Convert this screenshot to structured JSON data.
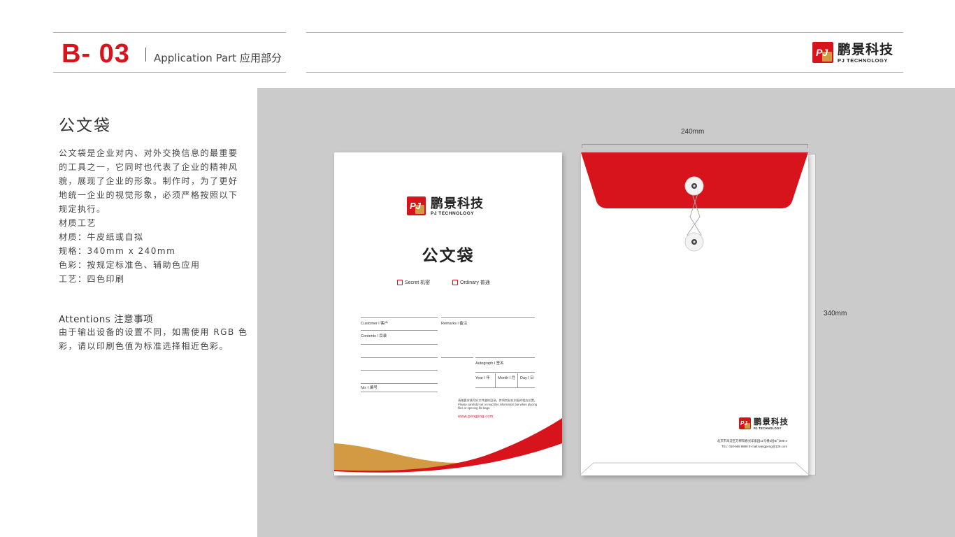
{
  "header": {
    "page_code": "B- 03",
    "section_title": "Application Part 应用部分"
  },
  "brand": {
    "name_cn": "鹏景科技",
    "name_en": "PJ TECHNOLOGY",
    "mark_letters": "PJ",
    "colors": {
      "red": "#d7141b",
      "gold": "#d39a43"
    }
  },
  "description": {
    "heading": "公文袋",
    "lines": [
      "公文袋是企业对内、对外交换信息的最重要",
      "的工具之一，它同时也代表了企业的精神风",
      "貌，展现了企业的形象。制作时，为了更好",
      "地统一企业的视觉形象，必须严格按照以下",
      "规定执行。",
      "材质工艺",
      "材质：牛皮纸或自拟",
      "规格：340mm x 240mm",
      "色彩：按规定标准色、辅助色应用",
      "工艺：四色印刷"
    ],
    "attentions_title": "Attentions 注意事项",
    "attentions_lines": [
      "由于输出设备的设置不同，如需使用 RGB 色",
      "彩，请以印刷色值为标准选择相近色彩。"
    ]
  },
  "front": {
    "title": "公文袋",
    "checkbox_secret": "Secret 机密",
    "checkbox_ordinary": "Ordinary 普通",
    "label_customer": "Customer l 客户",
    "label_remarks": "Remarks l 备注",
    "label_contents": "Contents l 目录",
    "label_autograph": "Autograph l 签名",
    "label_year": "Year l 年",
    "label_month": "Month l 月",
    "label_day": "Day l 日",
    "label_no": "No. l 编号",
    "note_line1": "请按要求填写好文件盒的目录，并将其贴在封面的相应位置。",
    "note_line2": "Please carefully set or read this information bar when placing files or opening file bags.",
    "url": "www.pengjing.com"
  },
  "back": {
    "address": "北京市海淀区万柳阳春光华家园11号楼2层B门205-4",
    "contact": "TEL: 010-666 8888  E-mail:wangpeng@126.com"
  },
  "dimensions": {
    "width": "240mm",
    "height": "340mm"
  }
}
